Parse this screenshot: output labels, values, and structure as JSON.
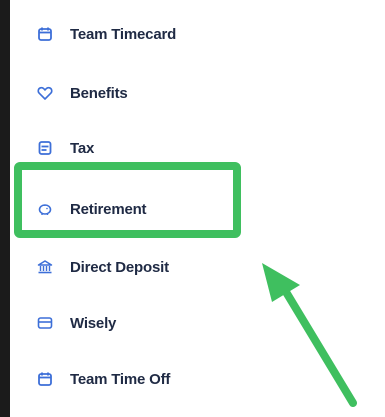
{
  "menu": {
    "items": [
      {
        "label": "Team Timecard",
        "icon": "calendar-icon"
      },
      {
        "label": "Benefits",
        "icon": "heart-icon"
      },
      {
        "label": "Tax",
        "icon": "document-icon"
      },
      {
        "label": "Retirement",
        "icon": "piggy-bank-icon"
      },
      {
        "label": "Direct Deposit",
        "icon": "bank-icon"
      },
      {
        "label": "Wisely",
        "icon": "card-icon"
      },
      {
        "label": "Team Time Off",
        "icon": "calendar-icon"
      }
    ]
  },
  "colors": {
    "accent_blue": "#3d6fd8",
    "highlight_green": "#3fbf5f",
    "text": "#1f2a44"
  }
}
